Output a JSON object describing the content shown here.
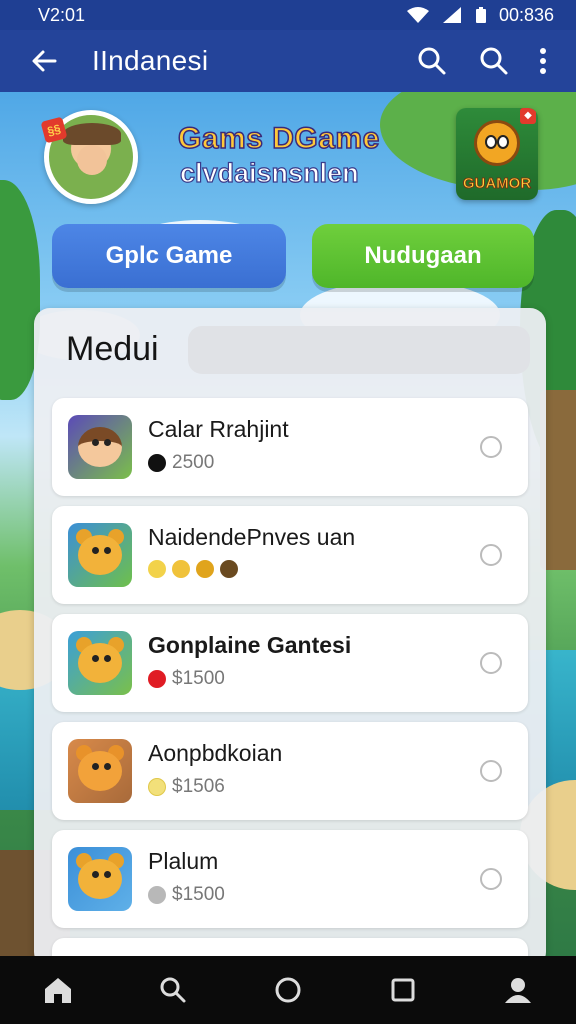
{
  "status_bar": {
    "time": "V2:01",
    "clock": "00:836"
  },
  "app_bar": {
    "title": "IIndanesi"
  },
  "hero": {
    "title": "Gams DGame",
    "subtitle": "clvdaisnsnlen",
    "badge_text": "§§",
    "logo_text": "GUAMOR",
    "logo_tag": "◆"
  },
  "buttons": {
    "primary": "Gplc Game",
    "secondary": "Nudugaan"
  },
  "panel": {
    "title": "Medui",
    "items": [
      {
        "name": "Calar Rrahjint",
        "value": "2500",
        "bold": false,
        "dot_color": "#111111"
      },
      {
        "name": "NaidendePnves uan",
        "value": "",
        "bold": false,
        "dots": [
          "#f2d24a",
          "#f0c23a",
          "#e0a41c",
          "#6a4a20"
        ]
      },
      {
        "name": "Gonplaine Gantesi",
        "value": "$1500",
        "bold": true,
        "dot_color": "#e01c24"
      },
      {
        "name": "Aonpbdkoian",
        "value": "$1506",
        "bold": false,
        "dot_color": "#f2e07a"
      },
      {
        "name": "Plalum",
        "value": "$1500",
        "bold": false,
        "dot_color": "#b8b8b8"
      }
    ]
  },
  "colors": {
    "status_bar": "#1f3f93",
    "app_bar": "#24449a",
    "primary_button": "#4d86e6",
    "secondary_button": "#6fcf3c"
  }
}
